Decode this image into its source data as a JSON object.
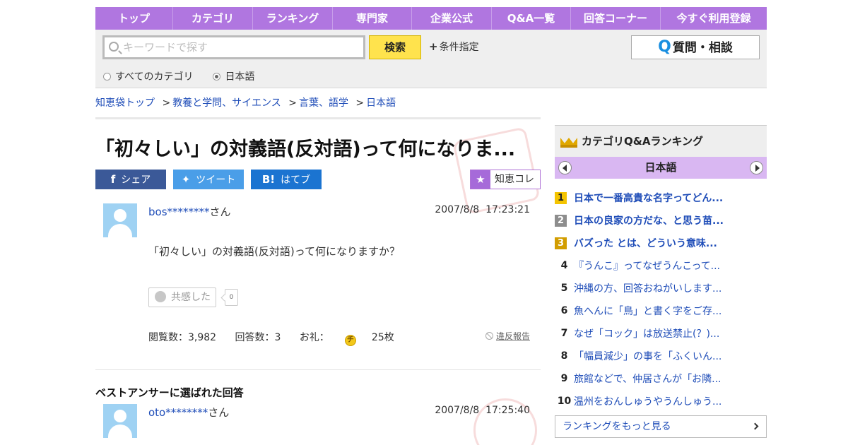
{
  "nav": [
    "トップ",
    "カテゴリ",
    "ランキング",
    "専門家",
    "企業公式",
    "Q&A一覧",
    "回答コーナー",
    "今すぐ利用登録"
  ],
  "search": {
    "placeholder": "キーワードで探す",
    "button": "検索",
    "conditions": "条件指定",
    "ask_button": "質問・相談",
    "radio_all": "すべてのカテゴリ",
    "radio_lang": "日本語"
  },
  "breadcrumb": [
    "知恵袋トップ",
    "教養と学問、サイエンス",
    "言葉、語学",
    "日本語"
  ],
  "question": {
    "title": "「初々しい」の対義語(反対語)って何になりま...",
    "share_fb": "シェア",
    "share_tw": "ツイート",
    "share_hb": "はてブ",
    "chiecolle": "知恵コレ",
    "user": "bos********",
    "san": "さん",
    "date": "2007/8/8",
    "time": "17:23:21",
    "body": "「初々しい」の対義語(反対語)って何になりますか？",
    "kyokan": "共感した",
    "kyokan_count": "0",
    "views_label": "閲覧数：3,982",
    "answers_label": "回答数：3",
    "reward_label": "お礼：",
    "reward_coin": "チ",
    "reward_value": "25枚",
    "report": "違反報告"
  },
  "best_answer": {
    "heading": "ベストアンサーに選ばれた回答",
    "user": "oto********",
    "san": "さん",
    "date": "2007/8/8",
    "time": "17:25:40"
  },
  "ranking": {
    "title": "カテゴリQ&Aランキング",
    "category": "日本語",
    "items": [
      {
        "rank": "1",
        "text": "日本で一番高貴な名字ってどん..."
      },
      {
        "rank": "2",
        "text": "日本の良家の方だな、と思う苗..."
      },
      {
        "rank": "3",
        "text": "バズった とは、どういう意味..."
      },
      {
        "rank": "4",
        "text": "『うんこ』ってなぜうんこって..."
      },
      {
        "rank": "5",
        "text": "沖縄の方、回答おねがいします..."
      },
      {
        "rank": "6",
        "text": "魚へんに「鳥」と書く字をご存..."
      },
      {
        "rank": "7",
        "text": "なぜ「コック」は放送禁止(？)..."
      },
      {
        "rank": "8",
        "text": "「幅員減少」の事を「ふくいん..."
      },
      {
        "rank": "9",
        "text": "旅館などで、仲居さんが「お隣..."
      },
      {
        "rank": "10",
        "text": "温州をおんしゅうやうんしゅう..."
      }
    ],
    "more": "ランキングをもっと見る"
  },
  "colors": {
    "nav": "#b076e0",
    "link": "#1f4db8",
    "search_button": "#ffe34d",
    "ranking_category": "#d9b7f2"
  }
}
